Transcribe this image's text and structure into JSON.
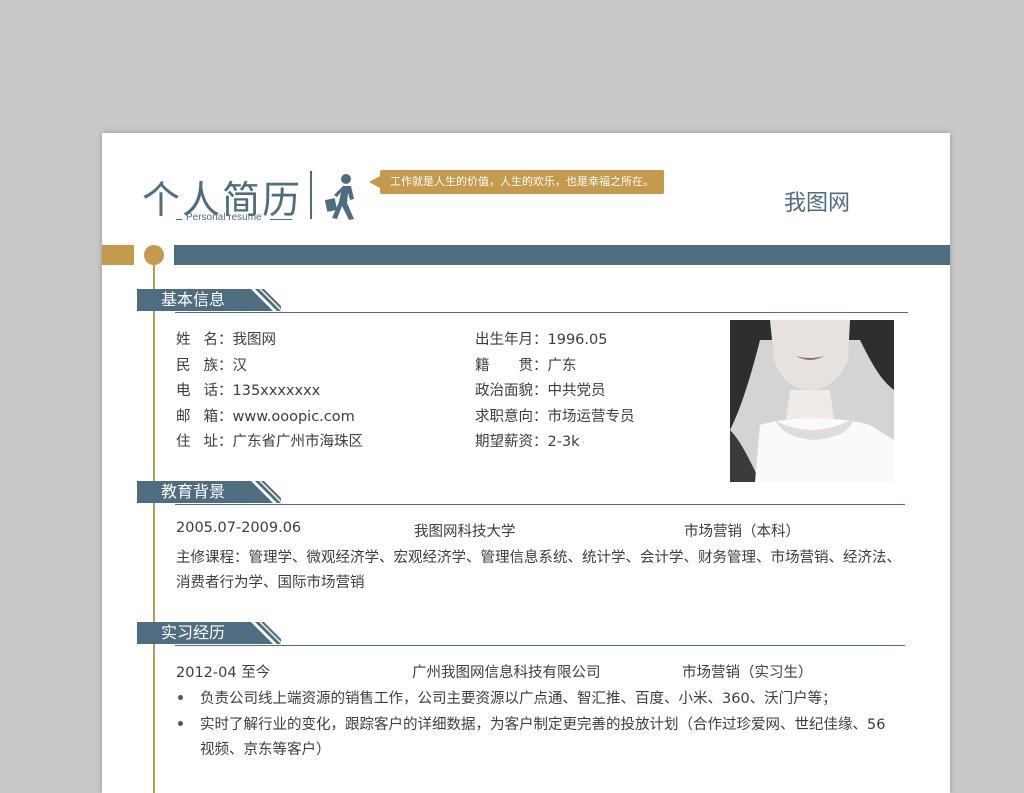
{
  "header": {
    "title": "个人简历",
    "subtitle": "Personal resume",
    "motto": "工作就是人生的价值，人生的欢乐，也是幸福之所在。",
    "brand": "我图网"
  },
  "sections": {
    "basic": "基本信息",
    "education": "教育背景",
    "internship": "实习经历"
  },
  "basic": {
    "left": [
      {
        "label": "姓名",
        "value": "：我图网"
      },
      {
        "label": "民族",
        "value": "：汉"
      },
      {
        "label": "电话",
        "value": "：135xxxxxxx"
      },
      {
        "label": "邮箱",
        "value": "：www.ooopic.com"
      },
      {
        "label": "住址",
        "value": "：广东省广州市海珠区"
      }
    ],
    "right": [
      {
        "label": "出生年月",
        "value": "：1996.05"
      },
      {
        "label": "籍贯",
        "value": "：广东"
      },
      {
        "label": "政治面貌",
        "value": "：中共党员"
      },
      {
        "label": "求职意向",
        "value": "：市场运营专员"
      },
      {
        "label": "期望薪资",
        "value": "：2-3k"
      }
    ]
  },
  "education": {
    "period": "2005.07-2009.06",
    "school": "我图网科技大学",
    "major": "市场营销（本科）",
    "courses_line1": "主修课程：管理学、微观经济学、宏观经济学、管理信息系统、统计学、会计学、财务管理、市场营销、经济法、",
    "courses_line2": "消费者行为学、国际市场营销"
  },
  "internship": {
    "period": "2012-04 至今",
    "company": "广州我图网信息科技有限公司",
    "role": "市场营销（实习生）",
    "bullet1": "负责公司线上端资源的销售工作，公司主要资源以广点通、智汇推、百度、小米、360、沃门户等；",
    "bullet2_line1": "实时了解行业的变化，跟踪客户的详细数据，为客户制定更完善的投放计划（合作过珍爱网、世纪佳缘、56",
    "bullet2_line2": "视频、京东等客户）"
  },
  "icons": {
    "walker": "walking-businessman-icon",
    "photo": "profile-photo"
  },
  "colors": {
    "accent": "#4f6d80",
    "gold": "#c49a4e"
  }
}
